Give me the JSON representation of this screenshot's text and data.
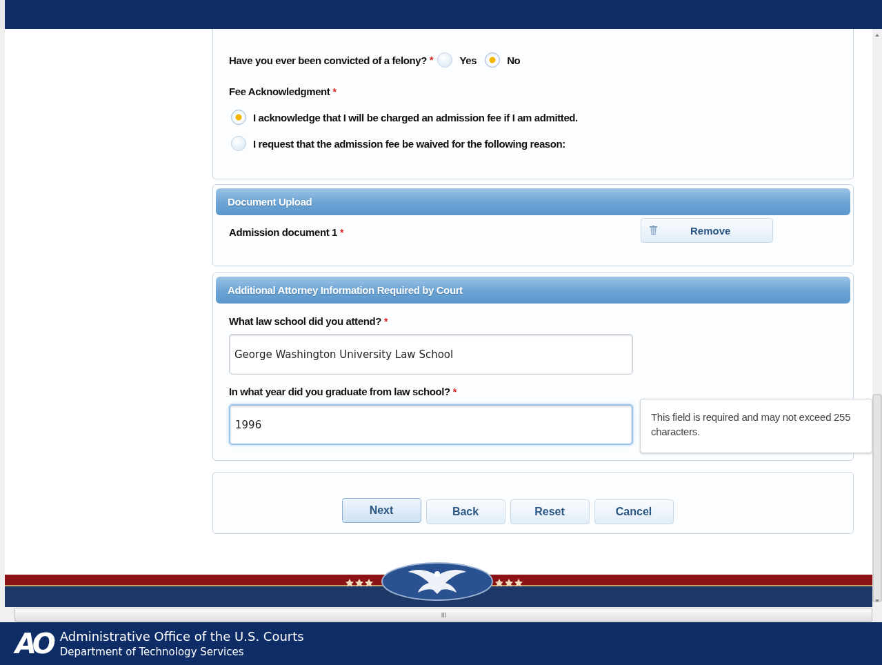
{
  "felony": {
    "label": "Have you ever been convicted of a felony?",
    "required_mark": "*",
    "options": [
      {
        "label": "Yes",
        "selected": false
      },
      {
        "label": "No",
        "selected": true
      }
    ]
  },
  "fee": {
    "label": "Fee Acknowledgment",
    "required_mark": "*",
    "options": [
      {
        "label": "I acknowledge that I will be charged an admission fee if I am admitted.",
        "selected": true
      },
      {
        "label": "I request that the admission fee be waived for the following reason:",
        "selected": false
      }
    ]
  },
  "upload": {
    "title": "Document Upload",
    "document": {
      "label": "Admission document 1",
      "required_mark": "*"
    },
    "remove_button": "Remove"
  },
  "attorney": {
    "title": "Additional Attorney Information Required by Court",
    "fields": [
      {
        "label": "What law school did you attend?",
        "required_mark": "*",
        "value": "George Washington University Law School",
        "focused": false
      },
      {
        "label": "In what year did you graduate from law school?",
        "required_mark": "*",
        "value": "1996",
        "focused": true
      }
    ]
  },
  "tooltip": "This field is required and may not exceed 255 characters.",
  "buttons": [
    {
      "label": "Next",
      "default": true
    },
    {
      "label": "Back",
      "default": false
    },
    {
      "label": "Reset",
      "default": false
    },
    {
      "label": "Cancel",
      "default": false
    }
  ],
  "footer": {
    "logo": "AO",
    "title": "Administrative Office of the U.S. Courts",
    "subtitle": "Department of Technology Services"
  }
}
